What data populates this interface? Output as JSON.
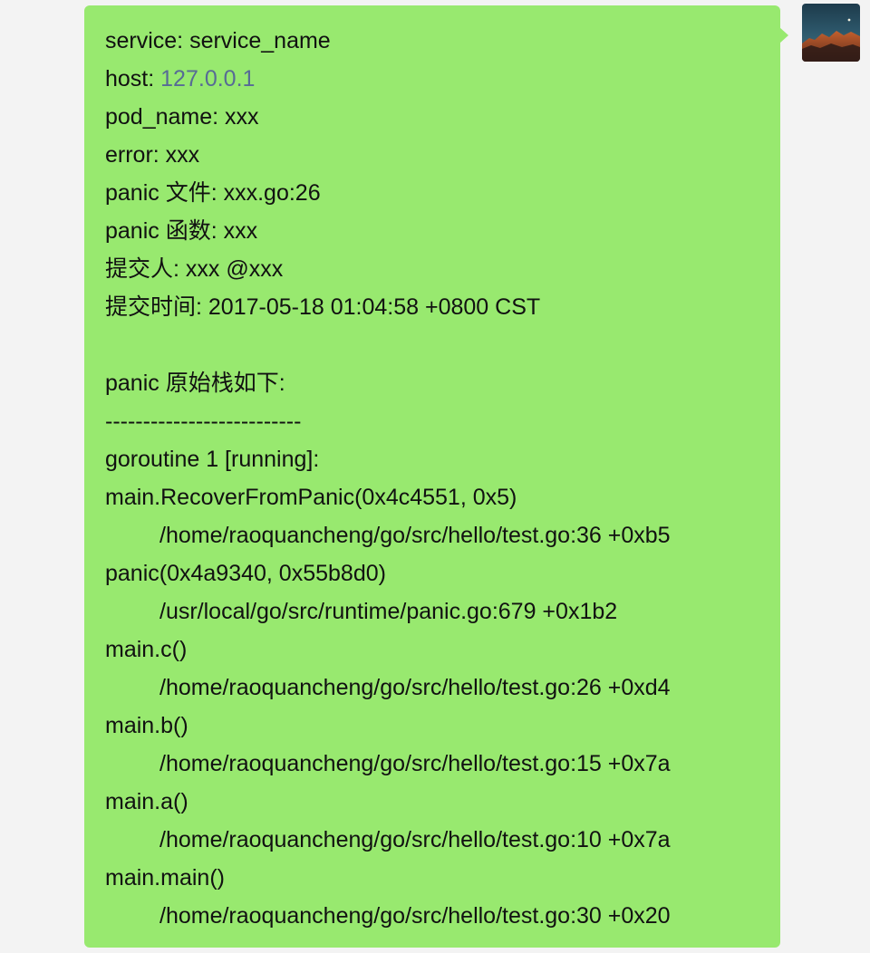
{
  "message": {
    "lines": [
      {
        "text": "service: service_name"
      },
      {
        "label": "host: ",
        "link": "127.0.0.1"
      },
      {
        "text": "pod_name: xxx"
      },
      {
        "text": "error: xxx"
      },
      {
        "text": "panic 文件: xxx.go:26"
      },
      {
        "text": "panic 函数: xxx"
      },
      {
        "text": "提交人: xxx @xxx"
      },
      {
        "text": "提交时间: 2017-05-18 01:04:58 +0800 CST"
      },
      {
        "text": ""
      },
      {
        "text": "panic 原始栈如下:"
      },
      {
        "text": "--------------------------"
      },
      {
        "text": "goroutine 1 [running]:"
      },
      {
        "text": "main.RecoverFromPanic(0x4c4551, 0x5)"
      },
      {
        "text": "/home/raoquancheng/go/src/hello/test.go:36 +0xb5"
      },
      {
        "text": "panic(0x4a9340, 0x55b8d0)"
      },
      {
        "text": "/usr/local/go/src/runtime/panic.go:679 +0x1b2"
      },
      {
        "text": "main.c()"
      },
      {
        "text": "/home/raoquancheng/go/src/hello/test.go:26 +0xd4"
      },
      {
        "text": "main.b()"
      },
      {
        "text": "/home/raoquancheng/go/src/hello/test.go:15 +0x7a"
      },
      {
        "text": "main.a()"
      },
      {
        "text": "/home/raoquancheng/go/src/hello/test.go:10 +0x7a"
      },
      {
        "text": "main.main()"
      },
      {
        "text": "/home/raoquancheng/go/src/hello/test.go:30 +0x20"
      }
    ]
  },
  "avatar": {
    "icon": "landscape-avatar-icon"
  },
  "colors": {
    "background": "#f3f3f3",
    "bubble": "#98e96f",
    "link": "#576b95",
    "text": "#111111"
  }
}
